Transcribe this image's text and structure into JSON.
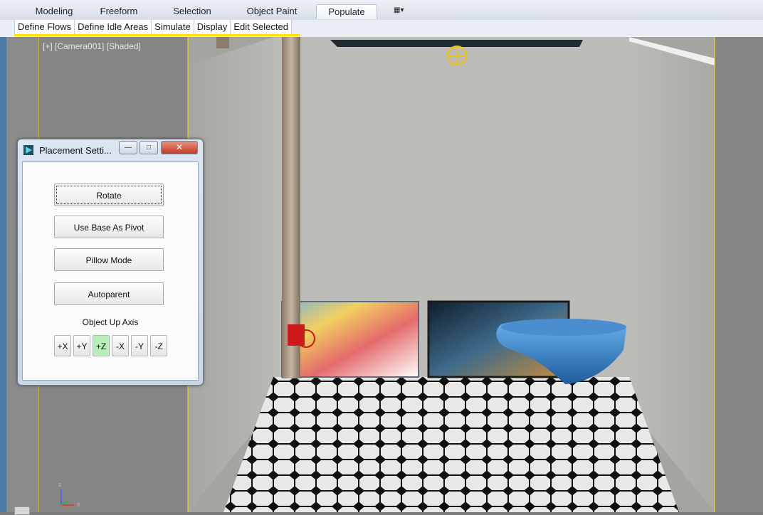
{
  "ribbon": {
    "tabs": [
      {
        "label": "Modeling"
      },
      {
        "label": "Freeform"
      },
      {
        "label": "Selection"
      },
      {
        "label": "Object Paint"
      },
      {
        "label": "Populate",
        "active": true
      }
    ],
    "panel_buttons": [
      "Define Flows",
      "Define Idle Areas",
      "Simulate",
      "Display",
      "Edit Selected"
    ]
  },
  "viewport": {
    "label": "[+] [Camera001] [Shaded]",
    "axis_labels": {
      "z": "z",
      "x": "x"
    }
  },
  "dialog": {
    "title": "Placement Setti...",
    "buttons": {
      "rotate": "Rotate",
      "use_base_as_pivot": "Use Base As Pivot",
      "pillow_mode": "Pillow Mode",
      "autoparent": "Autoparent"
    },
    "axis_label": "Object Up Axis",
    "axis_buttons": [
      {
        "label": "+X",
        "selected": false
      },
      {
        "label": "+Y",
        "selected": false
      },
      {
        "label": "+Z",
        "selected": true
      },
      {
        "label": "-X",
        "selected": false
      },
      {
        "label": "-Y",
        "selected": false
      },
      {
        "label": "-Z",
        "selected": false
      }
    ]
  },
  "colors": {
    "selection_highlight": "#ffe300",
    "active_axis": "#b7f0b7",
    "viewport_bg": "#7b7b7b"
  }
}
